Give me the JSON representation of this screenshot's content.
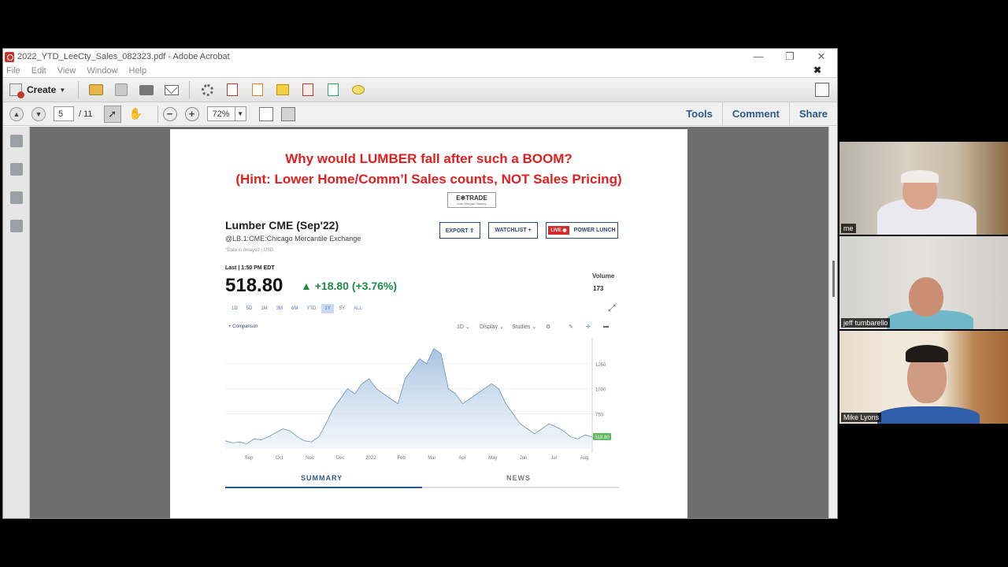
{
  "window": {
    "title": "2022_YTD_LeeCty_Sales_082323.pdf - Adobe Acrobat",
    "controls": [
      "—",
      "❐",
      "✕"
    ]
  },
  "menu": {
    "items": [
      "File",
      "Edit",
      "View",
      "Window",
      "Help"
    ],
    "close": "✖"
  },
  "toolbar": {
    "create_label": "Create",
    "icons": [
      "open-folder-icon",
      "save-icon",
      "print-icon",
      "email-icon",
      "settings-icon",
      "edit-pdf-icon",
      "export-icon",
      "sign-icon",
      "redact-icon",
      "attach-icon",
      "comment-icon"
    ]
  },
  "nav": {
    "page_current": "5",
    "page_total": "/ 11",
    "zoom": "72%",
    "links": [
      "Tools",
      "Comment",
      "Share"
    ]
  },
  "slide": {
    "headline1": "Why would LUMBER fall after such a BOOM?",
    "headline2": "(Hint:  Lower Home/Comm’l Sales counts, NOT Sales Pricing)",
    "logo": "E✻TRADE",
    "logo_sub": "from Morgan Stanley",
    "stock_title": "Lumber CME (Sep'22)",
    "stock_sub": "@LB.1:CME:Chicago Mercantile Exchange",
    "stock_note": "*Data is delayed | USD",
    "buttons": {
      "export": "EXPORT ⇪",
      "watchlist": "WATCHLIST +",
      "live": "LIVE ◉",
      "power_lunch": "POWER LUNCH"
    },
    "last_label": "Last | 1:50 PM EDT",
    "price": "518.80",
    "change": "▲ +18.80 (+3.76%)",
    "volume_label": "Volume",
    "volume_value": "173",
    "ranges": [
      "1D",
      "5D",
      "1M",
      "3M",
      "6M",
      "YTD",
      "1Y",
      "5Y",
      "ALL"
    ],
    "active_range": "1Y",
    "chart_tools": {
      "comparison": "+ Comparison",
      "interval": "1D ⌄",
      "display": "Display ⌄",
      "studies": "Studies ⌄"
    },
    "tabs": [
      "SUMMARY",
      "NEWS"
    ]
  },
  "chart_data": {
    "type": "area",
    "x_ticks": [
      "Sep",
      "Oct",
      "Nov",
      "Dec",
      "2022",
      "Feb",
      "Mar",
      "Apr",
      "May",
      "Jun",
      "Jul",
      "Aug"
    ],
    "y_ticks": [
      "1250",
      "1000",
      "750"
    ],
    "ylim": [
      400,
      1500
    ],
    "last_label": "518.80",
    "series": [
      {
        "values": [
          480,
          460,
          470,
          450,
          500,
          490,
          520,
          560,
          600,
          580,
          520,
          480,
          470,
          520,
          650,
          800,
          900,
          1000,
          950,
          1050,
          1100,
          1000,
          950,
          900,
          850,
          1100,
          1200,
          1300,
          1250,
          1400,
          1350,
          1000,
          950,
          850,
          900,
          950,
          1000,
          1050,
          1000,
          850,
          750,
          650,
          600,
          550,
          600,
          650,
          620,
          580,
          520,
          500,
          540,
          518.8
        ]
      }
    ]
  },
  "participants": [
    {
      "name": "me"
    },
    {
      "name": "jeff tumbarello"
    },
    {
      "name": "Mike Lyons"
    }
  ]
}
